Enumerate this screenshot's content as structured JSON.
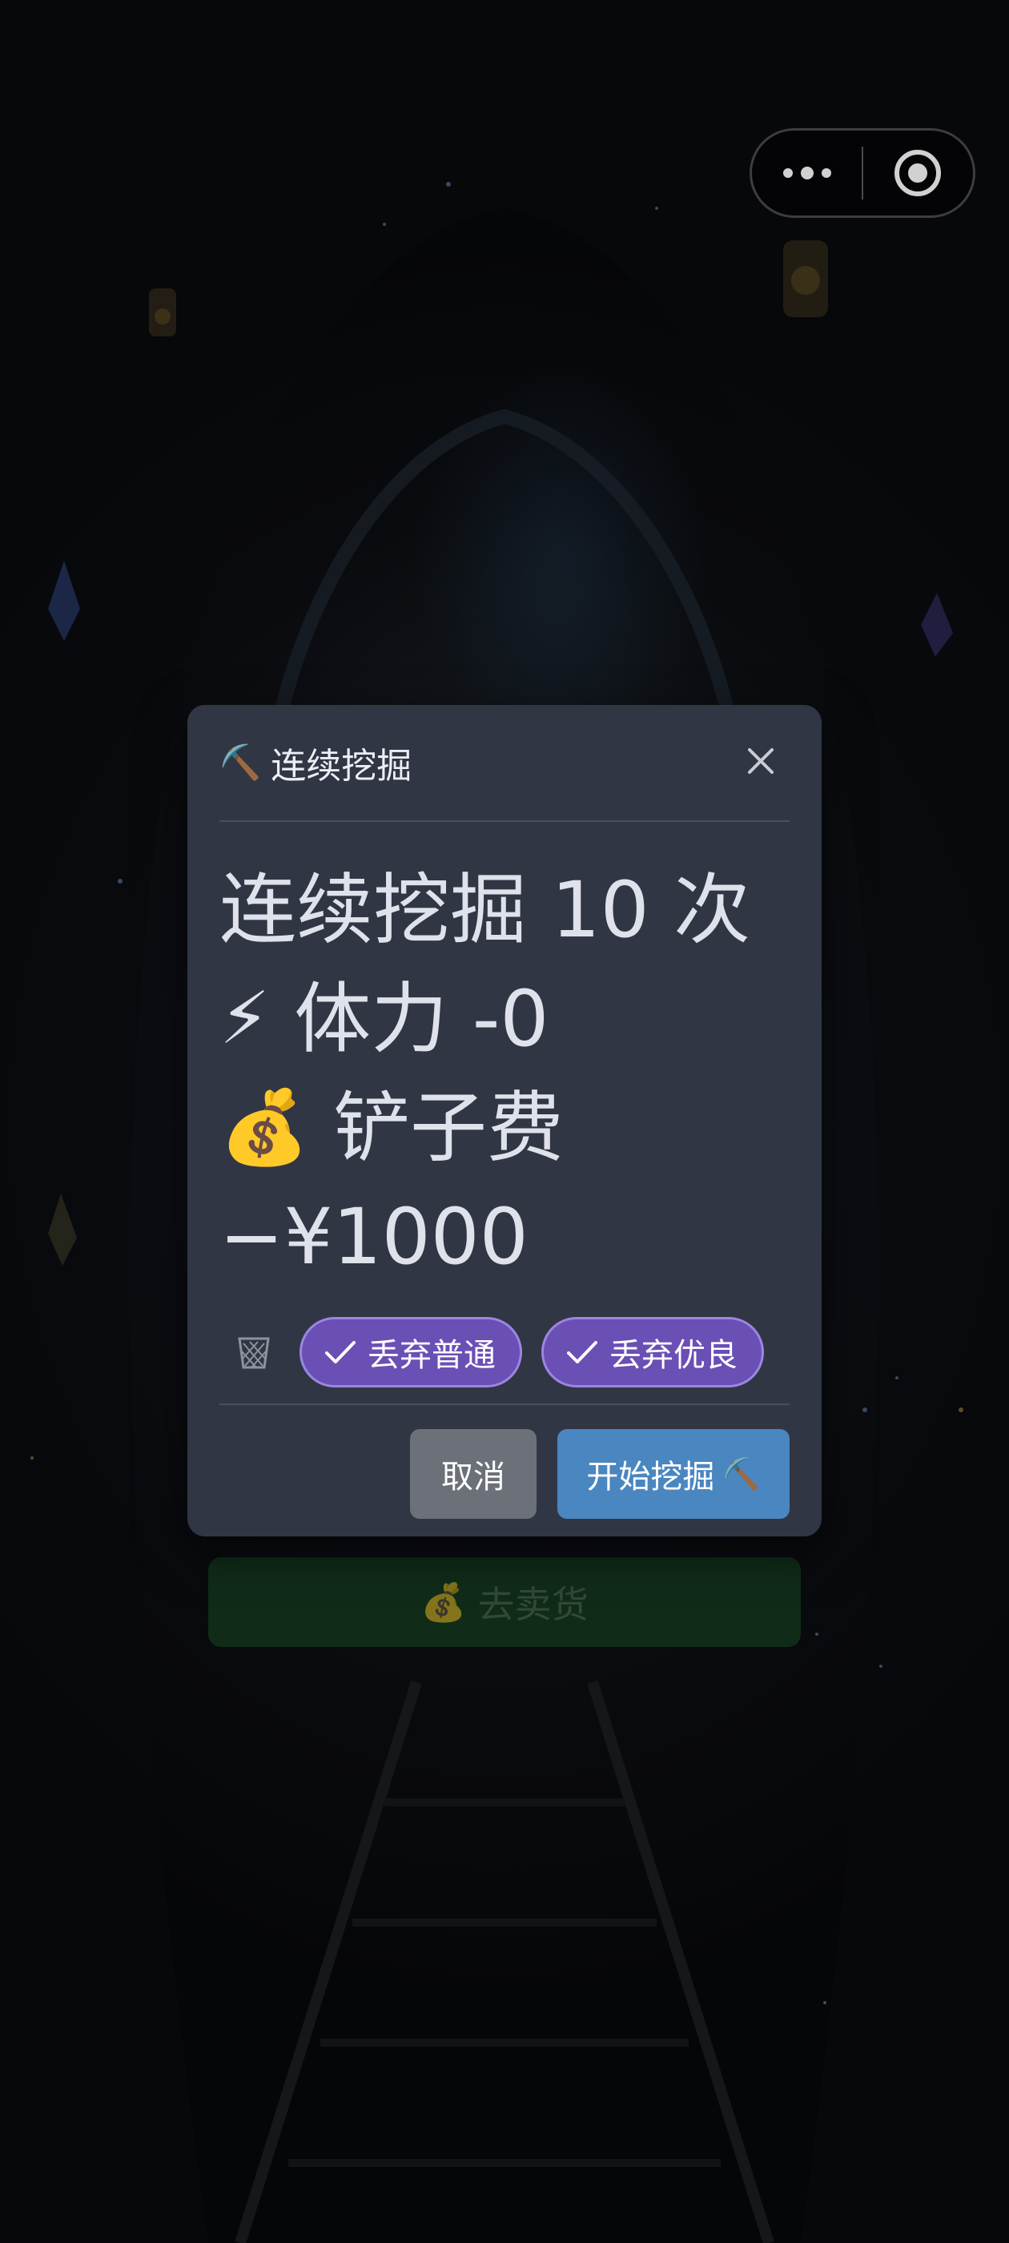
{
  "capsule": {
    "more_icon": "more-dots-icon",
    "close_icon": "target-circle-icon"
  },
  "sell_button": {
    "icon": "💰",
    "label": "去卖货"
  },
  "modal": {
    "title_icon": "⛏️",
    "title": "连续挖掘",
    "close_icon": "close-x-icon",
    "line1": "连续挖掘 10 次",
    "stamina_icon": "⚡",
    "stamina_text": "体力 -0",
    "fee_icon": "💰",
    "fee_text": "铲子费",
    "fee_amount": "−¥1000",
    "discard_icon": "trash-basket-icon",
    "options": [
      {
        "label": "丢弃普通",
        "checked": true
      },
      {
        "label": "丢弃优良",
        "checked": true
      }
    ],
    "cancel_label": "取消",
    "start_label": "开始挖掘",
    "start_icon": "⛏️"
  },
  "colors": {
    "modal_bg": "#313645",
    "chip_purple": "#6a4fb5",
    "start_blue": "#4a86c0",
    "cancel_gray": "#6c7078",
    "sell_green": "#14361f"
  }
}
